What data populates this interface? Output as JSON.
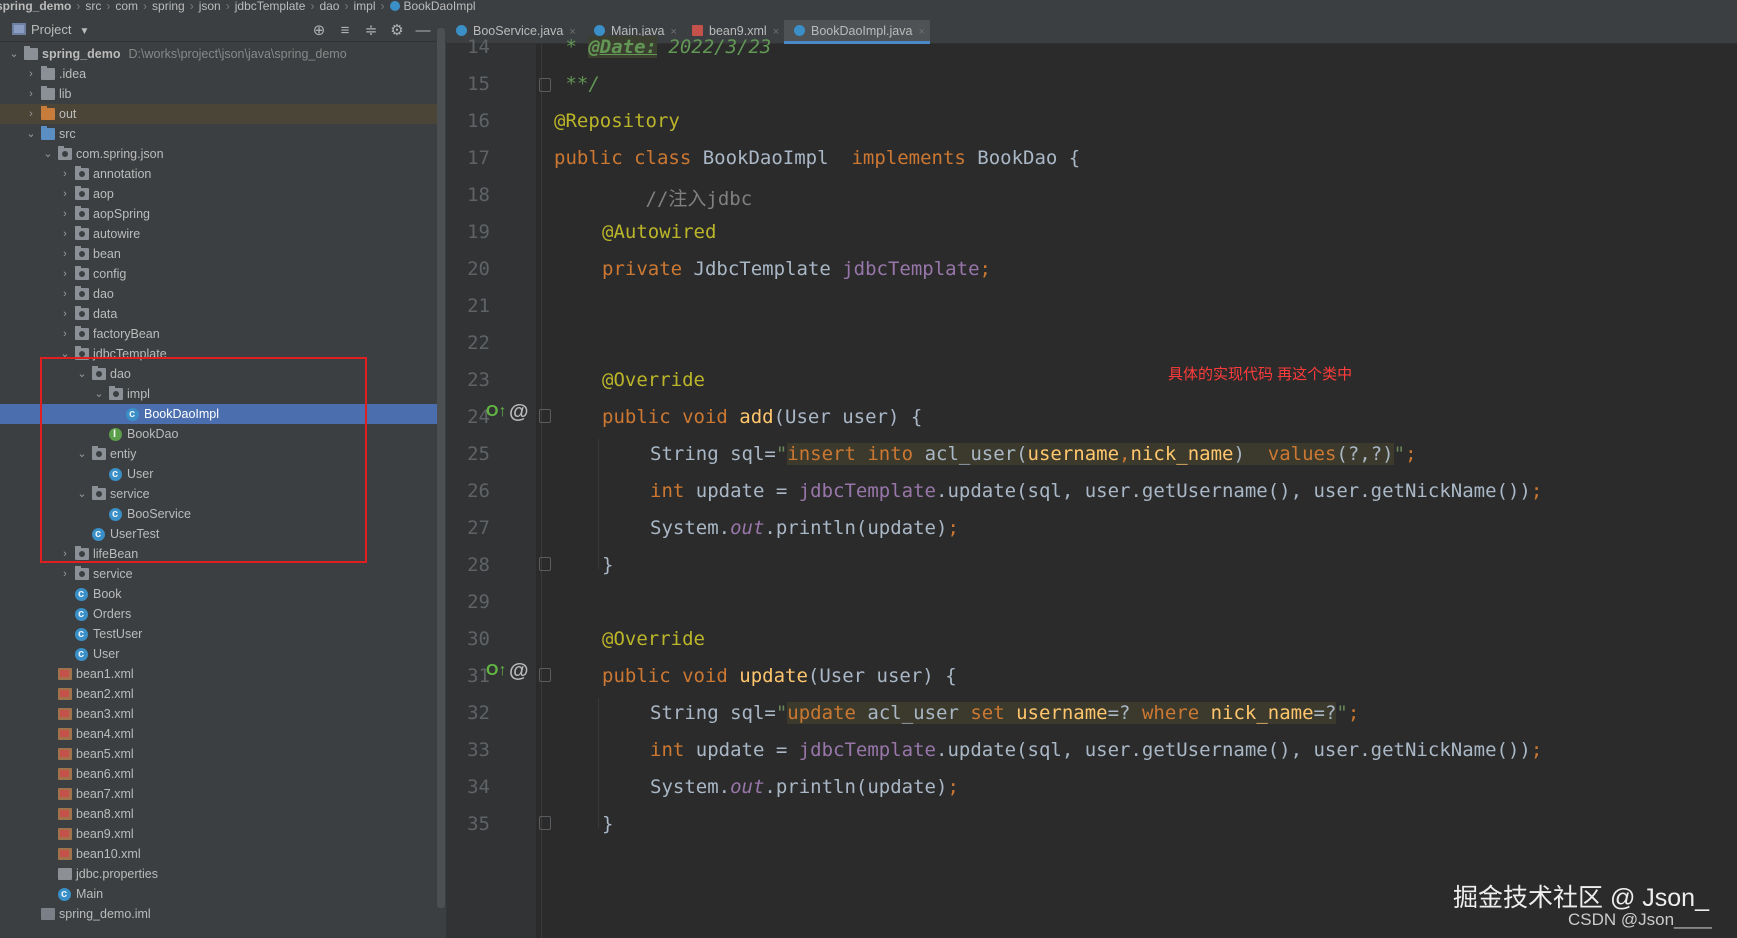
{
  "breadcrumb": [
    "spring_demo",
    "src",
    "com",
    "spring",
    "json",
    "jdbcTemplate",
    "dao",
    "impl",
    "BookDaoImpl"
  ],
  "project_panel": {
    "title": "Project",
    "dropdown": "▼",
    "tools": [
      "⊕",
      "≡",
      "≑",
      "⚙",
      "—"
    ]
  },
  "tree": [
    {
      "label": "spring_demo",
      "path": "D:\\works\\project\\json\\java\\spring_demo",
      "depth": 0,
      "arrow": "⌄",
      "icon": "module",
      "bold": true
    },
    {
      "label": ".idea",
      "depth": 1,
      "arrow": "›",
      "icon": "folder"
    },
    {
      "label": "lib",
      "depth": 1,
      "arrow": "›",
      "icon": "folder"
    },
    {
      "label": "out",
      "depth": 1,
      "arrow": "›",
      "icon": "folder-orange",
      "out": true
    },
    {
      "label": "src",
      "depth": 1,
      "arrow": "⌄",
      "icon": "folder-blue"
    },
    {
      "label": "com.spring.json",
      "depth": 2,
      "arrow": "⌄",
      "icon": "package"
    },
    {
      "label": "annotation",
      "depth": 3,
      "arrow": "›",
      "icon": "package"
    },
    {
      "label": "aop",
      "depth": 3,
      "arrow": "›",
      "icon": "package"
    },
    {
      "label": "aopSpring",
      "depth": 3,
      "arrow": "›",
      "icon": "package"
    },
    {
      "label": "autowire",
      "depth": 3,
      "arrow": "›",
      "icon": "package"
    },
    {
      "label": "bean",
      "depth": 3,
      "arrow": "›",
      "icon": "package"
    },
    {
      "label": "config",
      "depth": 3,
      "arrow": "›",
      "icon": "package"
    },
    {
      "label": "dao",
      "depth": 3,
      "arrow": "›",
      "icon": "package"
    },
    {
      "label": "data",
      "depth": 3,
      "arrow": "›",
      "icon": "package"
    },
    {
      "label": "factoryBean",
      "depth": 3,
      "arrow": "›",
      "icon": "package"
    },
    {
      "label": "jdbcTemplate",
      "depth": 3,
      "arrow": "⌄",
      "icon": "package"
    },
    {
      "label": "dao",
      "depth": 4,
      "arrow": "⌄",
      "icon": "package"
    },
    {
      "label": "impl",
      "depth": 5,
      "arrow": "⌄",
      "icon": "package"
    },
    {
      "label": "BookDaoImpl",
      "depth": 6,
      "arrow": "",
      "icon": "class",
      "selected": true
    },
    {
      "label": "BookDao",
      "depth": 5,
      "arrow": "",
      "icon": "interface"
    },
    {
      "label": "entiy",
      "depth": 4,
      "arrow": "⌄",
      "icon": "package"
    },
    {
      "label": "User",
      "depth": 5,
      "arrow": "",
      "icon": "class"
    },
    {
      "label": "service",
      "depth": 4,
      "arrow": "⌄",
      "icon": "package"
    },
    {
      "label": "BooService",
      "depth": 5,
      "arrow": "",
      "icon": "class"
    },
    {
      "label": "UserTest",
      "depth": 4,
      "arrow": "",
      "icon": "class"
    },
    {
      "label": "lifeBean",
      "depth": 3,
      "arrow": "›",
      "icon": "package"
    },
    {
      "label": "service",
      "depth": 3,
      "arrow": "›",
      "icon": "package"
    },
    {
      "label": "Book",
      "depth": 3,
      "arrow": "",
      "icon": "class"
    },
    {
      "label": "Orders",
      "depth": 3,
      "arrow": "",
      "icon": "class"
    },
    {
      "label": "TestUser",
      "depth": 3,
      "arrow": "",
      "icon": "class"
    },
    {
      "label": "User",
      "depth": 3,
      "arrow": "",
      "icon": "class"
    },
    {
      "label": "bean1.xml",
      "depth": 2,
      "arrow": "",
      "icon": "xml"
    },
    {
      "label": "bean2.xml",
      "depth": 2,
      "arrow": "",
      "icon": "xml"
    },
    {
      "label": "bean3.xml",
      "depth": 2,
      "arrow": "",
      "icon": "xml"
    },
    {
      "label": "bean4.xml",
      "depth": 2,
      "arrow": "",
      "icon": "xml"
    },
    {
      "label": "bean5.xml",
      "depth": 2,
      "arrow": "",
      "icon": "xml"
    },
    {
      "label": "bean6.xml",
      "depth": 2,
      "arrow": "",
      "icon": "xml"
    },
    {
      "label": "bean7.xml",
      "depth": 2,
      "arrow": "",
      "icon": "xml"
    },
    {
      "label": "bean8.xml",
      "depth": 2,
      "arrow": "",
      "icon": "xml"
    },
    {
      "label": "bean9.xml",
      "depth": 2,
      "arrow": "",
      "icon": "xml"
    },
    {
      "label": "bean10.xml",
      "depth": 2,
      "arrow": "",
      "icon": "xml"
    },
    {
      "label": "jdbc.properties",
      "depth": 2,
      "arrow": "",
      "icon": "properties"
    },
    {
      "label": "Main",
      "depth": 2,
      "arrow": "",
      "icon": "class"
    },
    {
      "label": "spring_demo.iml",
      "depth": 1,
      "arrow": "",
      "icon": "iml"
    }
  ],
  "tabs": [
    {
      "label": "BooService.java",
      "icon": "class",
      "close": "×"
    },
    {
      "label": "Main.java",
      "icon": "class",
      "close": "×"
    },
    {
      "label": "bean9.xml",
      "icon": "xml",
      "close": "×"
    },
    {
      "label": "BookDaoImpl.java",
      "icon": "class",
      "close": "×",
      "active": true
    }
  ],
  "editor": {
    "line_numbers": [
      "14",
      "15",
      "16",
      "17",
      "18",
      "19",
      "20",
      "21",
      "22",
      "23",
      "24",
      "25",
      "26",
      "27",
      "28",
      "29",
      "30",
      "31",
      "32",
      "33",
      "34",
      "35"
    ],
    "annotation_note": "具体的实现代码 再这个类中",
    "gutter_override": "O↑",
    "gutter_at": "@"
  },
  "code": {
    "l14_star": " * ",
    "l14_tag": "@Date:",
    "l14_date": " 2022/3/23",
    "l15": " **/",
    "l16": "@Repository",
    "l17_kw1": "public class ",
    "l17_name": "BookDaoImpl  ",
    "l17_kw2": "implements ",
    "l17_rest": "BookDao {",
    "l18": "        //注入jdbc",
    "l19": "@Autowired",
    "l20_kw": "private ",
    "l20_type": "JdbcTemplate ",
    "l20_field": "jdbcTemplate",
    "l20_semi": ";",
    "l23": "@Override",
    "l24_kw": "public void ",
    "l24_fn": "add",
    "l24_rest": "(User user) {",
    "l25_pre": "String sql=",
    "l25_q1": "\"",
    "l25_kw1": "insert into ",
    "l25_tbl": "acl_user(",
    "l25_c1": "username",
    "l25_comma": ",",
    "l25_c2": "nick_name",
    "l25_close": ")  ",
    "l25_kw2": "values",
    "l25_params": "(?,?)",
    "l25_q2": "\"",
    "l25_semi": ";",
    "l26_kw": "int ",
    "l26_a": "update = ",
    "l26_f": "jdbcTemplate",
    "l26_b": ".update(sql, user.getUsername(), user.getNickName())",
    "l26_semi": ";",
    "l27_a": "System.",
    "l27_out": "out",
    "l27_b": ".println(update)",
    "l27_semi": ";",
    "l28": "}",
    "l30": "@Override",
    "l31_kw": "public void ",
    "l31_fn": "update",
    "l31_rest": "(User user) {",
    "l32_pre": "String sql=",
    "l32_q1": "\"",
    "l32_kw1": "update ",
    "l32_tbl": "acl_user ",
    "l32_kw2": "set ",
    "l32_c1": "username",
    "l32_eq1": "=? ",
    "l32_kw3": "where ",
    "l32_c2": "nick_name",
    "l32_eq2": "=?",
    "l32_q2": "\"",
    "l32_semi": ";",
    "l33_kw": "int ",
    "l33_a": "update = ",
    "l33_f": "jdbcTemplate",
    "l33_b": ".update(sql, user.getUsername(), user.getNickName())",
    "l33_semi": ";",
    "l34_a": "System.",
    "l34_out": "out",
    "l34_b": ".println(update)",
    "l34_semi": ";",
    "l35": "}"
  },
  "watermark": {
    "main": "掘金技术社区 @ Json_",
    "sub": "CSDN @Json____"
  },
  "colors": {
    "selection": "#4b6eaf",
    "annotation_box": "#e02020",
    "note_text": "#ff3b3b",
    "keyword": "#cc7832",
    "annotation": "#bbb529",
    "field": "#9876aa",
    "method": "#ffc66d"
  }
}
